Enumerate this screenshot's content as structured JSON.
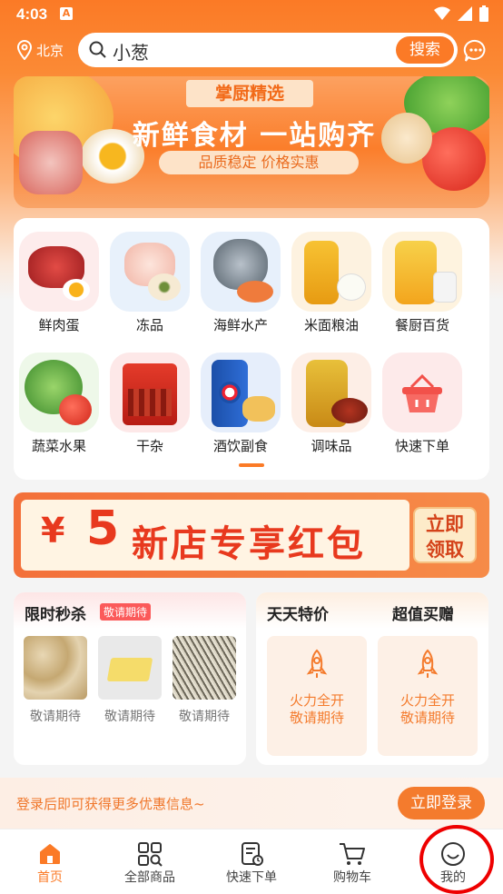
{
  "status": {
    "time": "4:03"
  },
  "header": {
    "location": "北京",
    "search_value": "小葱",
    "search_button": "搜索"
  },
  "banner": {
    "tag": "掌厨精选",
    "title": "新鲜食材 一站购齐",
    "subtitle": "品质稳定 价格实惠"
  },
  "categories": [
    {
      "label": "鲜肉蛋",
      "icon": "meat-egg"
    },
    {
      "label": "冻品",
      "icon": "frozen-food"
    },
    {
      "label": "海鲜水产",
      "icon": "seafood"
    },
    {
      "label": "米面粮油",
      "icon": "rice-oil"
    },
    {
      "label": "餐厨百货",
      "icon": "kitchen-goods"
    },
    {
      "label": "蔬菜水果",
      "icon": "vegetable-fruit"
    },
    {
      "label": "干杂",
      "icon": "dried-goods"
    },
    {
      "label": "酒饮副食",
      "icon": "drinks"
    },
    {
      "label": "调味品",
      "icon": "seasoning"
    },
    {
      "label": "快速下单",
      "icon": "basket"
    }
  ],
  "coupon": {
    "currency": "¥",
    "amount": "5",
    "text": "新店专享红包",
    "claim_line1": "立即",
    "claim_line2": "领取"
  },
  "flash_sale": {
    "title": "限时秒杀",
    "badge": "敬请期待",
    "items": [
      {
        "label": "敬请期待"
      },
      {
        "label": "敬请期待"
      },
      {
        "label": "敬请期待"
      }
    ]
  },
  "daily": {
    "title_left": "天天特价",
    "title_right": "超值买赠",
    "boxes": [
      {
        "line1": "火力全开",
        "line2": "敬请期待"
      },
      {
        "line1": "火力全开",
        "line2": "敬请期待"
      }
    ]
  },
  "login_bar": {
    "text": "登录后即可获得更多优惠信息~",
    "button": "立即登录"
  },
  "tabs": [
    {
      "label": "首页",
      "icon": "home-icon",
      "active": true
    },
    {
      "label": "全部商品",
      "icon": "grid-search-icon",
      "active": false
    },
    {
      "label": "快速下单",
      "icon": "order-icon",
      "active": false
    },
    {
      "label": "购物车",
      "icon": "cart-icon",
      "active": false
    },
    {
      "label": "我的",
      "icon": "smile-icon",
      "active": false
    }
  ],
  "colors": {
    "brand": "#fb7a26",
    "coupon_red": "#e8391e",
    "annotation_red": "#e00000"
  }
}
